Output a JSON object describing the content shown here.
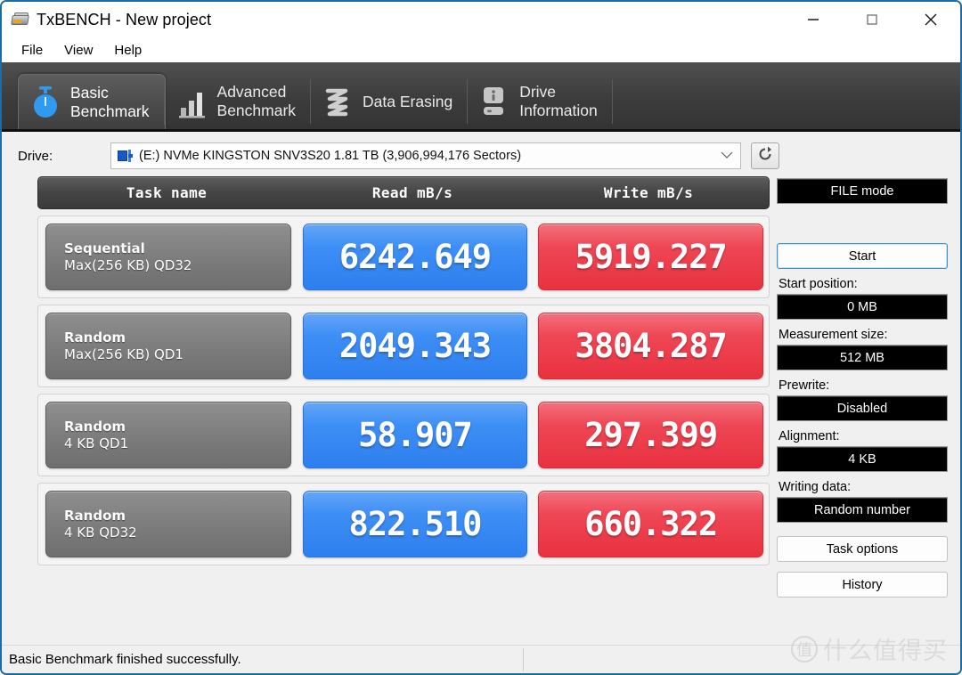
{
  "window": {
    "title": "TxBENCH - New project",
    "app_icon": "drive-icon",
    "minimize_label": "—",
    "maximize_label": "□",
    "close_label": "✕"
  },
  "menu": {
    "items": [
      {
        "label": "File"
      },
      {
        "label": "View"
      },
      {
        "label": "Help"
      }
    ]
  },
  "tabs": [
    {
      "label": "Basic\nBenchmark",
      "icon": "stopwatch-icon",
      "active": true
    },
    {
      "label": "Advanced\nBenchmark",
      "icon": "bar-chart-icon",
      "active": false
    },
    {
      "label": "Data Erasing",
      "icon": "shredder-icon",
      "active": false
    },
    {
      "label": "Drive\nInformation",
      "icon": "hdd-info-icon",
      "active": false
    }
  ],
  "drive": {
    "label": "Drive:",
    "value": "(E:) NVMe KINGSTON SNV3S20  1.81 TB (3,906,994,176 Sectors)",
    "icon": "drive-chip-icon",
    "dropdown_icon": "chevron-down-icon",
    "refresh_icon": "refresh-icon"
  },
  "table": {
    "headers": {
      "name": "Task name",
      "read": "Read mB/s",
      "write": "Write mB/s"
    },
    "rows": [
      {
        "task_line1": "Sequential",
        "task_line2": "Max(256 KB) QD32",
        "read": "6242.649",
        "write": "5919.227"
      },
      {
        "task_line1": "Random",
        "task_line2": "Max(256 KB) QD1",
        "read": "2049.343",
        "write": "3804.287"
      },
      {
        "task_line1": "Random",
        "task_line2": "4 KB QD1",
        "read": "58.907",
        "write": "297.399"
      },
      {
        "task_line1": "Random",
        "task_line2": "4 KB QD32",
        "read": "822.510",
        "write": "660.322"
      }
    ]
  },
  "panel": {
    "mode_value": "FILE mode",
    "start_button": "Start",
    "start_position_label": "Start position:",
    "start_position_value": "0 MB",
    "measurement_size_label": "Measurement size:",
    "measurement_size_value": "512 MB",
    "prewrite_label": "Prewrite:",
    "prewrite_value": "Disabled",
    "alignment_label": "Alignment:",
    "alignment_value": "4 KB",
    "writing_data_label": "Writing data:",
    "writing_data_value": "Random number",
    "task_options_button": "Task options",
    "history_button": "History"
  },
  "status": {
    "message": "Basic Benchmark finished successfully."
  },
  "watermark": {
    "mark": "值",
    "text": "什么值得买"
  },
  "colors": {
    "read_chip": "#3d8ef5",
    "write_chip": "#ef4655",
    "tab_active": "#4a4a4a",
    "window_border": "#1c6ca8"
  }
}
